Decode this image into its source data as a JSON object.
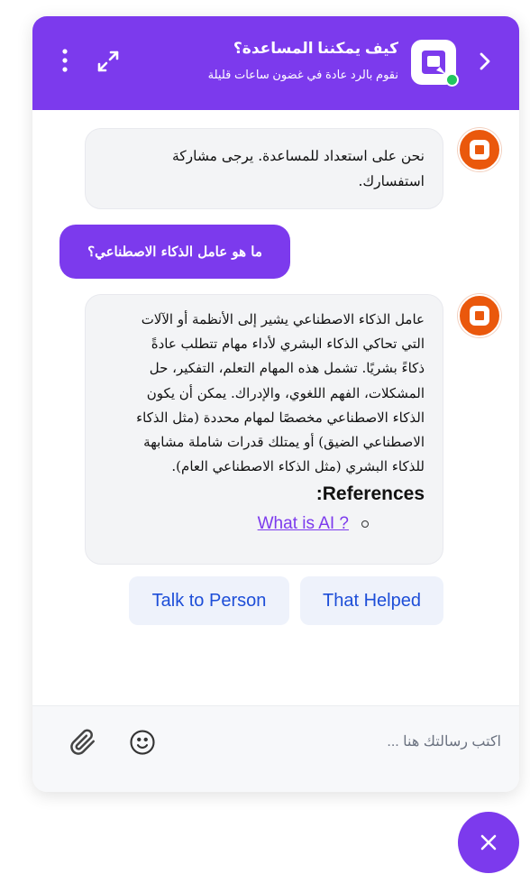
{
  "header": {
    "title": "كيف يمكننا المساعدة؟",
    "subtitle": "نقوم بالرد عادة في غضون ساعات قليلة",
    "menu_icon": "more-vertical-icon",
    "expand_icon": "expand-icon",
    "collapse_icon": "chevron-right-icon",
    "online_status_color": "#22c55e"
  },
  "theme": {
    "accent": "#7c3aed",
    "bot_avatar": "#ea580c",
    "quick_reply_text": "#1d4ed8"
  },
  "messages": [
    {
      "from": "bot",
      "lines": [
        "نحن على استعداد للمساعدة. يرجى مشاركة",
        "استفسارك."
      ]
    },
    {
      "from": "user",
      "text": "ما هو عامل الذكاء الاصطناعي؟"
    },
    {
      "from": "bot",
      "lines": [
        "عامل الذكاء الاصطناعي يشير إلى الأنظمة أو الآلات",
        "التي تحاكي الذكاء البشري لأداء مهام تتطلب عادةً",
        "ذكاءً بشريًا. تشمل هذه المهام التعلم، التفكير، حل",
        "المشكلات، الفهم اللغوي، والإدراك. يمكن أن يكون",
        "الذكاء الاصطناعي مخصصًا لمهام محددة (مثل الذكاء",
        "الاصطناعي الضيق) أو يمتلك قدرات شاملة مشابهة",
        "للذكاء البشري (مثل الذكاء الاصطناعي العام)."
      ],
      "references_title": "References:",
      "references": [
        "What is AI ?"
      ]
    }
  ],
  "quick_replies": [
    "Talk to Person",
    "That Helped"
  ],
  "composer": {
    "placeholder": "اكتب رسالتك هنا ...",
    "value": "",
    "attach_icon": "paperclip-icon",
    "emoji_icon": "smiley-icon"
  },
  "launcher": {
    "icon": "close-icon"
  }
}
